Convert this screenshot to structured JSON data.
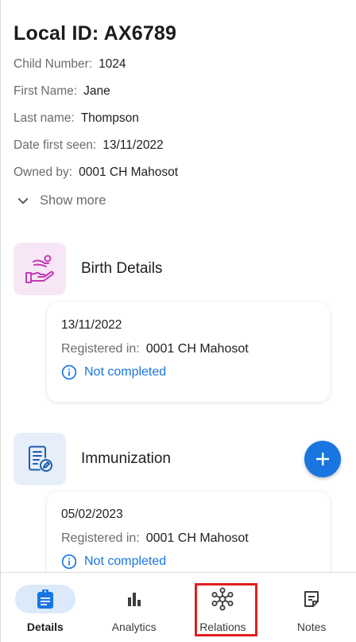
{
  "header": {
    "title": "Local ID: AX6789",
    "fields": [
      {
        "label": "Child Number:",
        "value": "1024"
      },
      {
        "label": "First Name:",
        "value": "Jane"
      },
      {
        "label": "Last name:",
        "value": "Thompson"
      },
      {
        "label": "Date first seen:",
        "value": "13/11/2022"
      },
      {
        "label": "Owned by:",
        "value": "0001 CH Mahosot"
      }
    ],
    "show_more": "Show more"
  },
  "birth": {
    "title": "Birth Details",
    "icon": "hand-baby-icon",
    "card": {
      "date": "13/11/2022",
      "registered_label": "Registered in:",
      "registered_value": "0001 CH Mahosot",
      "status": "Not completed"
    }
  },
  "immunization": {
    "title": "Immunization",
    "icon": "form-edit-icon",
    "card": {
      "date": "05/02/2023",
      "registered_label": "Registered in:",
      "registered_value": "0001 CH Mahosot",
      "status": "Not completed"
    }
  },
  "nav": {
    "items": [
      {
        "label": "Details",
        "icon": "assignment-icon",
        "active": true
      },
      {
        "label": "Analytics",
        "icon": "bar-chart-icon",
        "active": false
      },
      {
        "label": "Relations",
        "icon": "hub-network-icon",
        "active": false
      },
      {
        "label": "Notes",
        "icon": "note-icon",
        "active": false
      }
    ]
  },
  "colors": {
    "accent": "#1976e0",
    "active_pill": "#dbe9fb",
    "birth_icon_bg": "#f7e6f6",
    "immunization_icon_bg": "#e6eef9",
    "highlight": "#e02020"
  }
}
